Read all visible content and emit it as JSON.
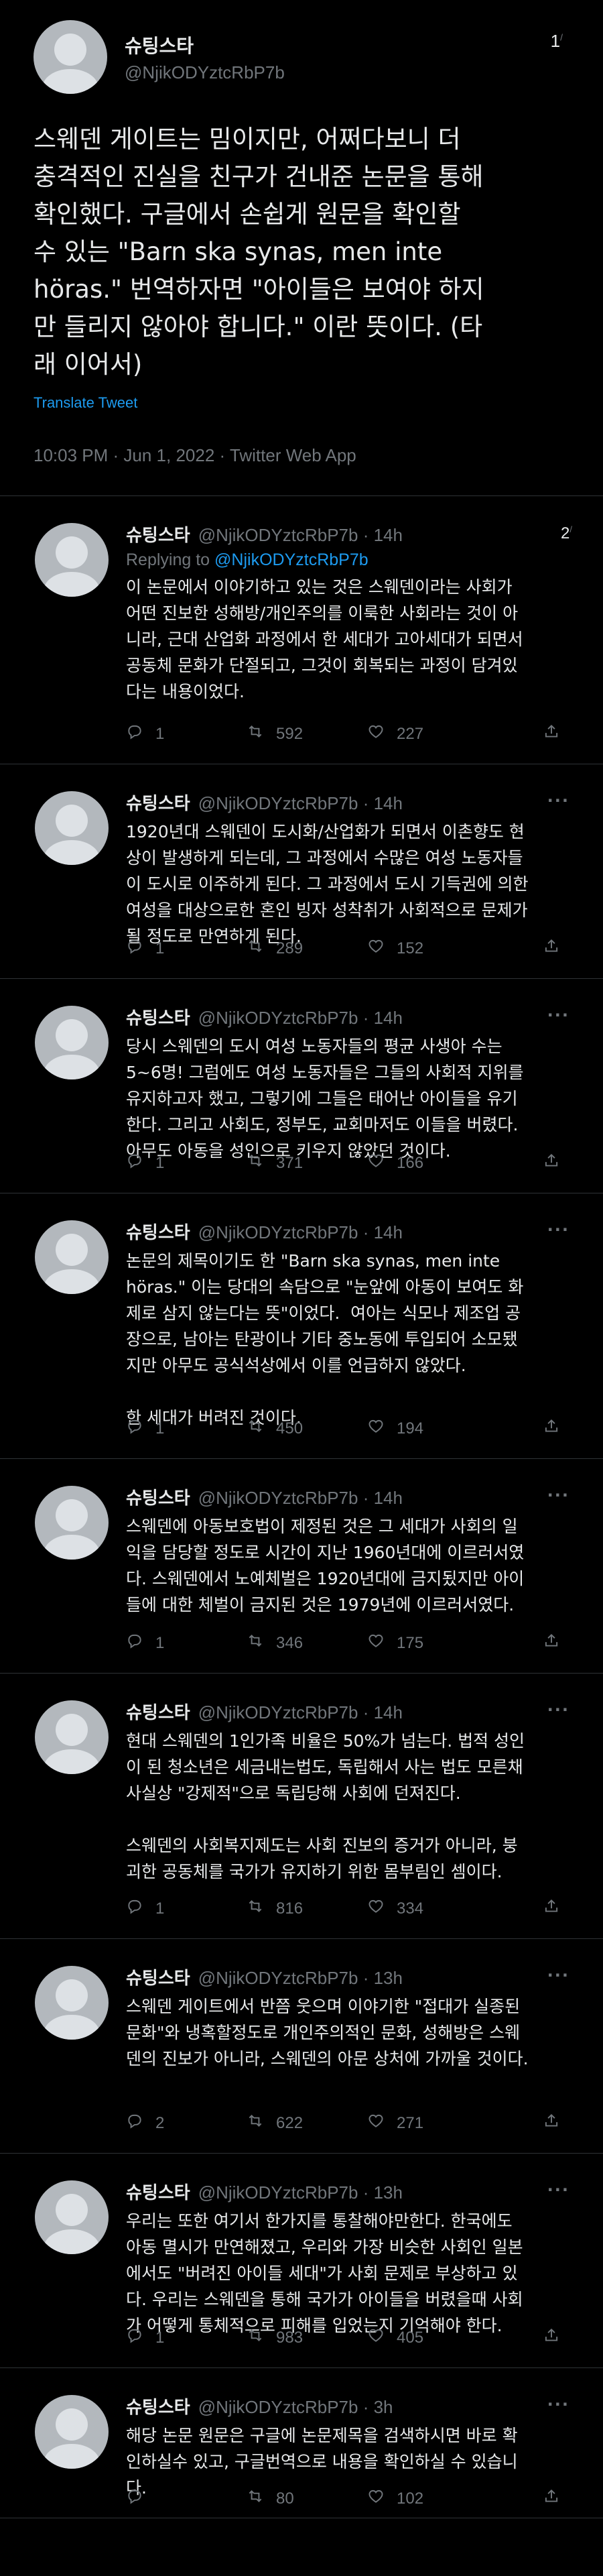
{
  "main": {
    "name": "슈팅스타",
    "handle": "@NjikODYztcRbP7b",
    "thread_no": "1",
    "thread_sup": "/",
    "text": "스웨덴 게이트는 밈이지만, 어쩌다보니 더\n충격적인 진실을 친구가 건내준 논문을 통해\n확인했다. 구글에서 손쉽게 원문을 확인할\n수 있는 \"Barn ska synas, men inte\nhöras.\" 번역하자면 \"아이들은 보여야 하지\n만 들리지 않아야 합니다.\" 이란 뜻이다. (타\n래 이어서)",
    "translate": "Translate Tweet",
    "meta": "10:03 PM · Jun 1, 2022 · Twitter Web App"
  },
  "replies": [
    {
      "name": "슈팅스타",
      "handle": "@NjikODYztcRbP7b · 14h",
      "thread_no": "2",
      "replying_prefix": "Replying to ",
      "replying_to": "@NjikODYztcRbP7b",
      "text": "이 논문에서 이야기하고 있는 것은 스웨덴이라는 사회가\n어떤 진보한 성해방/개인주의를 이룩한 사회라는 것이 아\n니라, 근대 산업화 과정에서 한 세대가 고아세대가 되면서\n공동체 문화가 단절되고, 그것이 회복되는 과정이 담겨있\n다는 내용이었다.",
      "replies": "1",
      "retweets": "592",
      "likes": "227"
    },
    {
      "name": "슈팅스타",
      "handle": "@NjikODYztcRbP7b · 14h",
      "text": "1920년대 스웨덴이 도시화/산업화가 되면서 이촌향도 현\n상이 발생하게 되는데, 그 과정에서 수많은 여성 노동자들\n이 도시로 이주하게 된다. 그 과정에서 도시 기득권에 의한\n여성을 대상으로한 혼인 빙자 성착취가 사회적으로 문제가\n될 정도로 만연하게 된다.",
      "replies": "1",
      "retweets": "289",
      "likes": "152"
    },
    {
      "name": "슈팅스타",
      "handle": "@NjikODYztcRbP7b · 14h",
      "text": "당시 스웨덴의 도시 여성 노동자들의 평균 사생아 수는\n5~6명! 그럼에도 여성 노동자들은 그들의 사회적 지위를\n유지하고자 했고, 그렇기에 그들은 태어난 아이들을 유기\n한다. 그리고 사회도, 정부도, 교회마저도 이들을 버렸다.\n아무도 아동을 성인으로 키우지 않았던 것이다.",
      "replies": "1",
      "retweets": "371",
      "likes": "166"
    },
    {
      "name": "슈팅스타",
      "handle": "@NjikODYztcRbP7b · 14h",
      "text": "논문의 제목이기도 한 \"Barn ska synas, men inte\nhöras.\" 이는 당대의 속담으로 \"눈앞에 아동이 보여도 화\n제로 삼지 않는다는 뜻\"이었다.  여아는 식모나 제조업 공\n장으로, 남아는 탄광이나 기타 중노동에 투입되어 소모됐\n지만 아무도 공식석상에서 이를 언급하지 않았다.\n\n한 세대가 버려진 것이다.",
      "replies": "1",
      "retweets": "450",
      "likes": "194"
    },
    {
      "name": "슈팅스타",
      "handle": "@NjikODYztcRbP7b · 14h",
      "text": "스웨덴에 아동보호법이 제정된 것은 그 세대가 사회의 일\n익을 담당할 정도로 시간이 지난 1960년대에 이르러서였\n다. 스웨덴에서 노예체벌은 1920년대에 금지됬지만 아이\n들에 대한 체벌이 금지된 것은 1979년에 이르러서였다.",
      "replies": "1",
      "retweets": "346",
      "likes": "175"
    },
    {
      "name": "슈팅스타",
      "handle": "@NjikODYztcRbP7b · 14h",
      "text": "현대 스웨덴의 1인가족 비율은 50%가 넘는다. 법적 성인\n이 된 청소년은 세금내는법도, 독립해서 사는 법도 모른채\n사실상 \"강제적\"으로 독립당해 사회에 던져진다.\n\n스웨덴의 사회복지제도는 사회 진보의 증거가 아니라, 붕\n괴한 공동체를 국가가 유지하기 위한 몸부림인 셈이다.",
      "replies": "1",
      "retweets": "816",
      "likes": "334"
    },
    {
      "name": "슈팅스타",
      "handle": "@NjikODYztcRbP7b · 13h",
      "text": "스웨덴 게이트에서 반쯤 웃으며 이야기한 \"접대가 실종된\n문화\"와 냉혹할정도로 개인주의적인 문화, 성해방은 스웨\n덴의 진보가 아니라, 스웨덴의 아문 상처에 가까울 것이다.",
      "replies": "2",
      "retweets": "622",
      "likes": "271"
    },
    {
      "name": "슈팅스타",
      "handle": "@NjikODYztcRbP7b · 13h",
      "text": "우리는 또한 여기서 한가지를 통찰해야만한다. 한국에도\n아동 멸시가 만연해졌고, 우리와 가장 비슷한 사회인 일본\n에서도 \"버려진 아이들 세대\"가 사회 문제로 부상하고 있\n다. 우리는 스웨덴을 통해 국가가 아이들을 버렸을때 사회\n가 어떻게 통체적으로 피해를 입었는지 기억해야 한다.",
      "replies": "1",
      "retweets": "983",
      "likes": "405"
    },
    {
      "name": "슈팅스타",
      "handle": "@NjikODYztcRbP7b · 3h",
      "text": "해당 논문 원문은 구글에 논문제목을 검색하시면 바로 확\n인하실수 있고, 구글번역으로 내용을 확인하실 수 있습니\n다.",
      "replies": "",
      "retweets": "80",
      "likes": "102"
    }
  ],
  "more_label": "···",
  "icons": {
    "reply": "reply-bubble-icon",
    "retweet": "retweet-icon",
    "like": "heart-icon",
    "share": "share-icon",
    "avatar": "default-avatar-icon"
  },
  "colors": {
    "background": "#000000",
    "text": "#e7e9ea",
    "muted": "#71767b",
    "link": "#1d9bf0",
    "divider": "#2f3336"
  }
}
